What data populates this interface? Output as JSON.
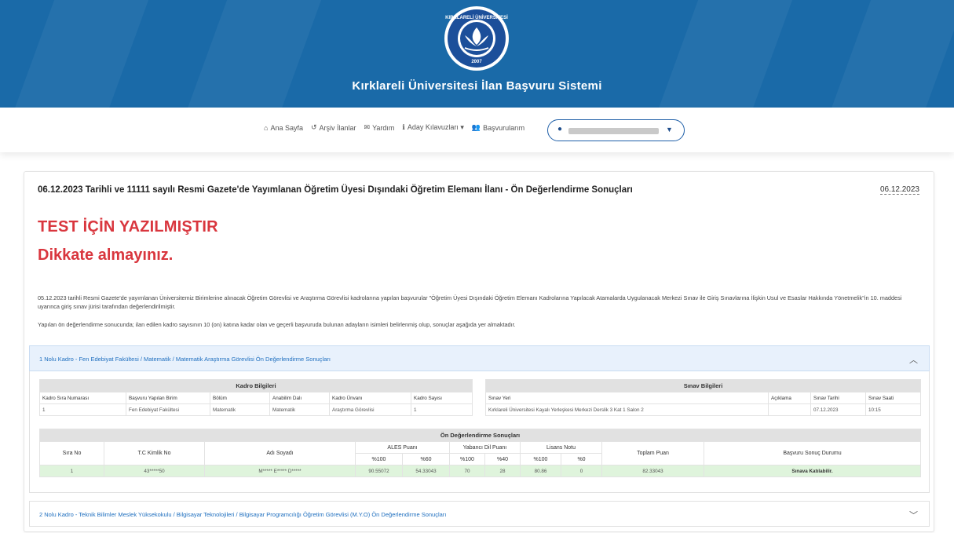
{
  "header": {
    "logo_text": "KIRKLARELİ ÜNİVERSİTESİ 2007",
    "site_title": "Kırklareli Üniversitesi İlan Başvuru Sistemi"
  },
  "nav": {
    "items": [
      {
        "icon": "home-icon",
        "glyph": "⌂",
        "label": "Ana Sayfa"
      },
      {
        "icon": "history-icon",
        "glyph": "↺",
        "label": "Arşiv İlanlar"
      },
      {
        "icon": "envelope-icon",
        "glyph": "✉",
        "label": "Yardım"
      },
      {
        "icon": "info-icon",
        "glyph": "ℹ",
        "label": "Aday Kılavuzları ▾"
      },
      {
        "icon": "users-icon",
        "glyph": "👥",
        "label": "Başvurularım"
      }
    ],
    "user_icon": "user-icon",
    "caret": "▼"
  },
  "announcement": {
    "title": "06.12.2023 Tarihli ve 11111 sayılı Resmi Gazete'de Yayımlanan Öğretim Üyesi Dışındaki Öğretim Elemanı İlanı - Ön Değerlendirme Sonuçları",
    "date": "06.12.2023",
    "warning_line1": "TEST İÇİN YAZILMIŞTIR",
    "warning_line2": "Dikkate almayınız.",
    "paragraph1": "05.12.2023 tarihli Resmi Gazete'de yayımlanan Üniversitemiz Birimlerine alınacak Öğretim Görevlisi ve Araştırma Görevlisi kadrolarına yapılan başvurular \"Öğretim Üyesi Dışındaki Öğretim Elemanı Kadrolarına Yapılacak Atamalarda Uygulanacak Merkezi Sınav ile Giriş Sınavlarına İlişkin Usul ve Esaslar Hakkında Yönetmelik\"in 10. maddesi uyarınca giriş sınav jürisi tarafından değerlendirilmiştir.",
    "paragraph2": "Yapılan ön değerlendirme sonucunda; ilan edilen kadro sayısının 10 (on) katına kadar olan ve geçerli başvuruda bulunan adayların isimleri belirlenmiş olup, sonuçlar aşağıda yer almaktadır."
  },
  "accordion1": {
    "label": "1 Nolu Kadro - Fen Edebiyat Fakültesi / Matematik / Matematik Araştırma Görevlisi Ön Değerlendirme Sonuçları",
    "chevron": "︿",
    "kadro": {
      "title": "Kadro Bilgileri",
      "headers": [
        "Kadro Sıra Numarası",
        "Başvuru Yapılan Birim",
        "Bölüm",
        "Anabilim Dalı",
        "Kadro Ünvanı",
        "Kadro Sayısı"
      ],
      "row": [
        "1",
        "Fen Edebiyat Fakültesi",
        "Matematik",
        "Matematik",
        "Araştırma Görevlisi",
        "1"
      ]
    },
    "sinav": {
      "title": "Sınav Bilgileri",
      "headers": [
        "Sınav Yeri",
        "Açıklama",
        "Sınav Tarihi",
        "Sınav Saati"
      ],
      "row": [
        "Kırklareli Üniversitesi Kayalı Yerleşkesi Merkezi Derslik 3 Kat 1 Salon 2",
        "",
        "07.12.2023",
        "10:15"
      ]
    },
    "sonuc": {
      "title": "Ön Değerlendirme Sonuçları",
      "group_headers": [
        "ALES Puanı",
        "Yabancı Dil Puanı",
        "Lisans Notu"
      ],
      "headers": [
        "Sıra No",
        "T.C Kimlik No",
        "Adı Soyadı",
        "Toplam Puan",
        "Başvuru Sonuç Durumu"
      ],
      "sub_headers": [
        "%100",
        "%60",
        "%100",
        "%40",
        "%100",
        "%0"
      ],
      "row": {
        "sira": "1",
        "tc": "43*****50",
        "ad": "M***** E***** D*****",
        "ales100": "90.55072",
        "ales60": "54.33043",
        "dil100": "70",
        "dil40": "28",
        "lisans100": "80.86",
        "lisans0": "0",
        "toplam": "82.33043",
        "durum": "Sınava Katılabilir."
      }
    }
  },
  "accordion2": {
    "label": "2 Nolu Kadro - Teknik Bilimler Meslek Yüksekokulu / Bilgisayar Teknolojileri / Bilgisayar Programcılığı Öğretim Görevlisi (M.Y.O) Ön Değerlendirme Sonuçları",
    "chevron": "﹀"
  },
  "colors": {
    "banner": "#1a6aa8",
    "warning": "#d9363e",
    "link": "#1f6fbf",
    "success_row": "#dff4dc"
  }
}
